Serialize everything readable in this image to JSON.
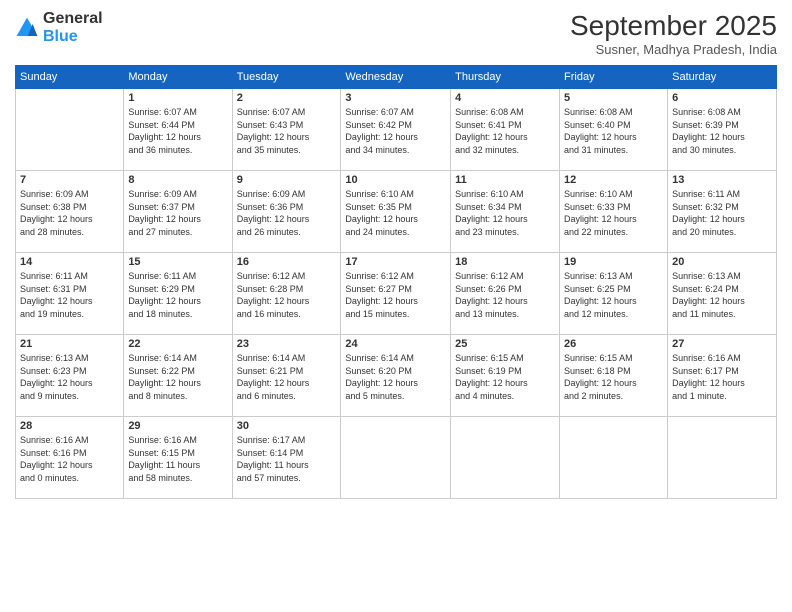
{
  "header": {
    "logo": {
      "general": "General",
      "blue": "Blue"
    },
    "title": "September 2025",
    "subtitle": "Susner, Madhya Pradesh, India"
  },
  "calendar": {
    "days_of_week": [
      "Sunday",
      "Monday",
      "Tuesday",
      "Wednesday",
      "Thursday",
      "Friday",
      "Saturday"
    ],
    "weeks": [
      [
        {
          "day": "",
          "info": ""
        },
        {
          "day": "1",
          "info": "Sunrise: 6:07 AM\nSunset: 6:44 PM\nDaylight: 12 hours\nand 36 minutes."
        },
        {
          "day": "2",
          "info": "Sunrise: 6:07 AM\nSunset: 6:43 PM\nDaylight: 12 hours\nand 35 minutes."
        },
        {
          "day": "3",
          "info": "Sunrise: 6:07 AM\nSunset: 6:42 PM\nDaylight: 12 hours\nand 34 minutes."
        },
        {
          "day": "4",
          "info": "Sunrise: 6:08 AM\nSunset: 6:41 PM\nDaylight: 12 hours\nand 32 minutes."
        },
        {
          "day": "5",
          "info": "Sunrise: 6:08 AM\nSunset: 6:40 PM\nDaylight: 12 hours\nand 31 minutes."
        },
        {
          "day": "6",
          "info": "Sunrise: 6:08 AM\nSunset: 6:39 PM\nDaylight: 12 hours\nand 30 minutes."
        }
      ],
      [
        {
          "day": "7",
          "info": "Sunrise: 6:09 AM\nSunset: 6:38 PM\nDaylight: 12 hours\nand 28 minutes."
        },
        {
          "day": "8",
          "info": "Sunrise: 6:09 AM\nSunset: 6:37 PM\nDaylight: 12 hours\nand 27 minutes."
        },
        {
          "day": "9",
          "info": "Sunrise: 6:09 AM\nSunset: 6:36 PM\nDaylight: 12 hours\nand 26 minutes."
        },
        {
          "day": "10",
          "info": "Sunrise: 6:10 AM\nSunset: 6:35 PM\nDaylight: 12 hours\nand 24 minutes."
        },
        {
          "day": "11",
          "info": "Sunrise: 6:10 AM\nSunset: 6:34 PM\nDaylight: 12 hours\nand 23 minutes."
        },
        {
          "day": "12",
          "info": "Sunrise: 6:10 AM\nSunset: 6:33 PM\nDaylight: 12 hours\nand 22 minutes."
        },
        {
          "day": "13",
          "info": "Sunrise: 6:11 AM\nSunset: 6:32 PM\nDaylight: 12 hours\nand 20 minutes."
        }
      ],
      [
        {
          "day": "14",
          "info": "Sunrise: 6:11 AM\nSunset: 6:31 PM\nDaylight: 12 hours\nand 19 minutes."
        },
        {
          "day": "15",
          "info": "Sunrise: 6:11 AM\nSunset: 6:29 PM\nDaylight: 12 hours\nand 18 minutes."
        },
        {
          "day": "16",
          "info": "Sunrise: 6:12 AM\nSunset: 6:28 PM\nDaylight: 12 hours\nand 16 minutes."
        },
        {
          "day": "17",
          "info": "Sunrise: 6:12 AM\nSunset: 6:27 PM\nDaylight: 12 hours\nand 15 minutes."
        },
        {
          "day": "18",
          "info": "Sunrise: 6:12 AM\nSunset: 6:26 PM\nDaylight: 12 hours\nand 13 minutes."
        },
        {
          "day": "19",
          "info": "Sunrise: 6:13 AM\nSunset: 6:25 PM\nDaylight: 12 hours\nand 12 minutes."
        },
        {
          "day": "20",
          "info": "Sunrise: 6:13 AM\nSunset: 6:24 PM\nDaylight: 12 hours\nand 11 minutes."
        }
      ],
      [
        {
          "day": "21",
          "info": "Sunrise: 6:13 AM\nSunset: 6:23 PM\nDaylight: 12 hours\nand 9 minutes."
        },
        {
          "day": "22",
          "info": "Sunrise: 6:14 AM\nSunset: 6:22 PM\nDaylight: 12 hours\nand 8 minutes."
        },
        {
          "day": "23",
          "info": "Sunrise: 6:14 AM\nSunset: 6:21 PM\nDaylight: 12 hours\nand 6 minutes."
        },
        {
          "day": "24",
          "info": "Sunrise: 6:14 AM\nSunset: 6:20 PM\nDaylight: 12 hours\nand 5 minutes."
        },
        {
          "day": "25",
          "info": "Sunrise: 6:15 AM\nSunset: 6:19 PM\nDaylight: 12 hours\nand 4 minutes."
        },
        {
          "day": "26",
          "info": "Sunrise: 6:15 AM\nSunset: 6:18 PM\nDaylight: 12 hours\nand 2 minutes."
        },
        {
          "day": "27",
          "info": "Sunrise: 6:16 AM\nSunset: 6:17 PM\nDaylight: 12 hours\nand 1 minute."
        }
      ],
      [
        {
          "day": "28",
          "info": "Sunrise: 6:16 AM\nSunset: 6:16 PM\nDaylight: 12 hours\nand 0 minutes."
        },
        {
          "day": "29",
          "info": "Sunrise: 6:16 AM\nSunset: 6:15 PM\nDaylight: 11 hours\nand 58 minutes."
        },
        {
          "day": "30",
          "info": "Sunrise: 6:17 AM\nSunset: 6:14 PM\nDaylight: 11 hours\nand 57 minutes."
        },
        {
          "day": "",
          "info": ""
        },
        {
          "day": "",
          "info": ""
        },
        {
          "day": "",
          "info": ""
        },
        {
          "day": "",
          "info": ""
        }
      ]
    ]
  }
}
